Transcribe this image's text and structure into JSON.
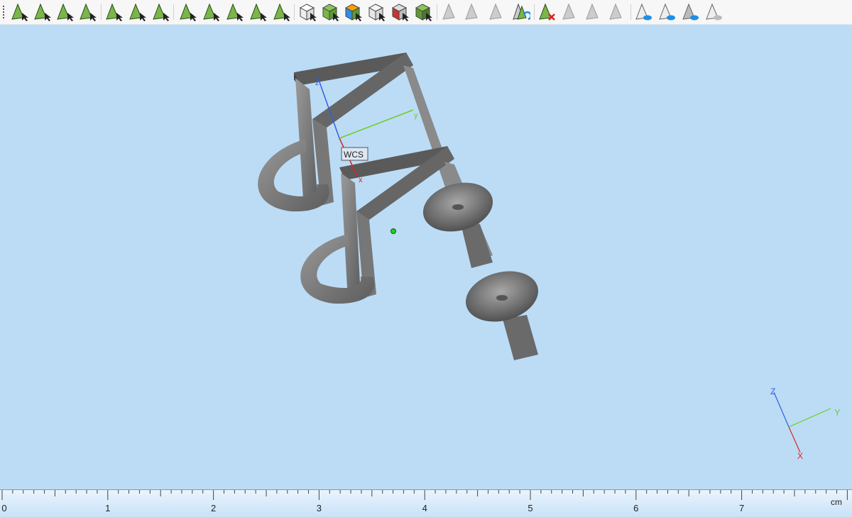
{
  "toolbar": {
    "items": [
      {
        "name": "select-vertex-icon",
        "style": "green"
      },
      {
        "name": "select-edge-icon",
        "style": "green"
      },
      {
        "name": "select-curve-icon",
        "style": "green"
      },
      {
        "name": "select-face-icon",
        "style": "green"
      },
      {
        "name": "select-rect-face-icon",
        "style": "green"
      },
      {
        "name": "select-blob-icon",
        "style": "green"
      },
      {
        "name": "select-wire-icon",
        "style": "green"
      },
      {
        "name": "select-mesh-face-icon",
        "style": "green"
      },
      {
        "name": "select-partial-mesh-icon",
        "style": "green"
      },
      {
        "name": "select-star-mesh-icon",
        "style": "green"
      },
      {
        "name": "select-wheel-icon",
        "style": "green"
      },
      {
        "name": "select-fan-icon",
        "style": "green"
      },
      {
        "name": "select-solid-icon",
        "style": "cube-white"
      },
      {
        "name": "select-shell-icon",
        "style": "cube-green"
      },
      {
        "name": "select-compound-icon",
        "style": "cube-color"
      },
      {
        "name": "select-hidden-solid-icon",
        "style": "cube-gray"
      },
      {
        "name": "select-inner-solid-icon",
        "style": "cube-red"
      },
      {
        "name": "select-group-icon",
        "style": "cube-dark"
      },
      {
        "name": "pick-point-icon",
        "style": "gray"
      },
      {
        "name": "pick-multi-icon",
        "style": "gray"
      },
      {
        "name": "pick-arrow-icon",
        "style": "gray"
      },
      {
        "name": "refresh-selection-icon",
        "style": "refresh"
      },
      {
        "name": "clear-selection-icon",
        "style": "delete"
      },
      {
        "name": "dashed-selection-icon",
        "style": "gray"
      },
      {
        "name": "copy-selection-icon",
        "style": "gray"
      },
      {
        "name": "plane-selection-icon",
        "style": "gray"
      },
      {
        "name": "show-icon",
        "style": "eye-light"
      },
      {
        "name": "show-refresh-icon",
        "style": "eye-refresh"
      },
      {
        "name": "show-only-icon",
        "style": "eye-dark"
      },
      {
        "name": "hide-icon",
        "style": "eye-gray"
      }
    ]
  },
  "viewport": {
    "wcs_label": "WCS",
    "model_axes": {
      "x": "x",
      "y": "y",
      "z": "z"
    },
    "triad": {
      "x": "X",
      "y": "Y",
      "z": "Z"
    },
    "colors": {
      "x": "#e02020",
      "y": "#6ad020",
      "z": "#3060e0",
      "background": "#bcdcf6",
      "model": "#8a8a8a"
    }
  },
  "ruler": {
    "unit": "cm",
    "labels": [
      "0",
      "1",
      "2",
      "3",
      "4",
      "5",
      "6",
      "7"
    ]
  }
}
